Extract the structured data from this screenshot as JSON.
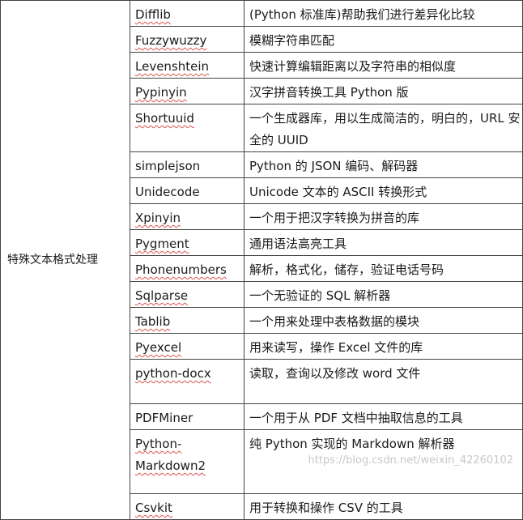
{
  "category": "特殊文本格式处理",
  "rows": [
    {
      "name": "Difflib",
      "desc": "(Python 标准库)帮助我们进行差异化比较"
    },
    {
      "name": "Fuzzywuzzy",
      "desc": "模糊字符串匹配"
    },
    {
      "name": "Levenshtein",
      "desc": "快速计算编辑距离以及字符串的相似度"
    },
    {
      "name": "Pypinyin",
      "desc": "汉字拼音转换工具 Python 版"
    },
    {
      "name": "Shortuuid",
      "desc": "一个生成器库，用以生成简洁的，明白的，URL 安全的 UUID"
    },
    {
      "name": "simplejson",
      "desc": "Python 的 JSON 编码、解码器"
    },
    {
      "name": "Unidecode",
      "desc": "Unicode 文本的 ASCII 转换形式"
    },
    {
      "name": "Xpinyin",
      "desc": "一个用于把汉字转换为拼音的库"
    },
    {
      "name": "Pygment",
      "desc": "通用语法高亮工具"
    },
    {
      "name": "Phonenumbers",
      "desc": "解析，格式化，储存，验证电话号码"
    },
    {
      "name": "Sqlparse",
      "desc": "一个无验证的 SQL 解析器"
    },
    {
      "name": "Tablib",
      "desc": "一个用来处理中表格数据的模块"
    },
    {
      "name": "Pyexcel",
      "desc": "用来读写，操作 Excel 文件的库"
    },
    {
      "name": "python-docx",
      "desc": "读取，查询以及修改 word 文件"
    },
    {
      "name": "PDFMiner",
      "desc": "一个用于从 PDF 文档中抽取信息的工具"
    },
    {
      "name": "Python-Markdown2",
      "desc": "纯 Python 实现的 Markdown 解析器"
    },
    {
      "name": "Csvkit",
      "desc": "用于转换和操作 CSV 的工具"
    }
  ],
  "watermark": "https://blog.csdn.net/weixin_42260102"
}
